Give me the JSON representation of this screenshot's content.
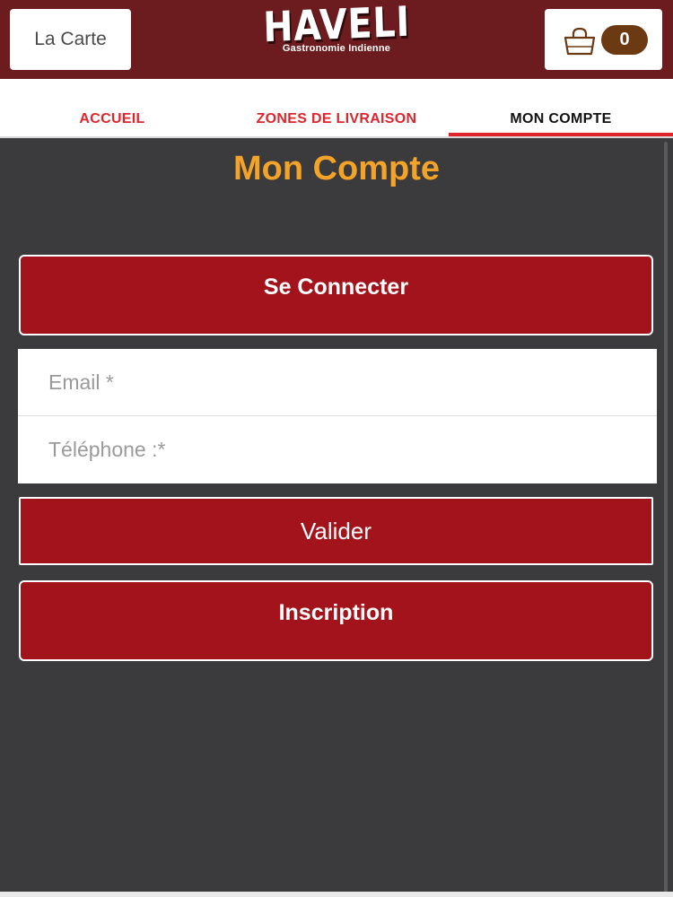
{
  "header": {
    "menu_button_label": "La Carte",
    "logo": {
      "name": "HAVELI",
      "tagline": "Gastronomie Indienne"
    },
    "cart": {
      "icon": "shopping-bag-icon",
      "count": "0"
    },
    "colors": {
      "header_bg": "#6c1b1e",
      "badge_bg": "#6b3a12"
    }
  },
  "nav": {
    "tabs": [
      {
        "label": "ACCUEIL",
        "active": false
      },
      {
        "label": "ZONES DE LIVRAISON",
        "active": false
      },
      {
        "label": "MON COMPTE",
        "active": true
      }
    ],
    "accent_color": "#e0242b"
  },
  "main": {
    "title": "Mon Compte",
    "login_button": "Se Connecter",
    "email_placeholder": "Email *",
    "phone_placeholder": "Téléphone :*",
    "email_value": "",
    "phone_value": "",
    "submit_button": "Valider",
    "signup_button": "Inscription",
    "colors": {
      "background": "#3b3a3c",
      "title": "#f3a428",
      "button": "#a3131b"
    }
  }
}
